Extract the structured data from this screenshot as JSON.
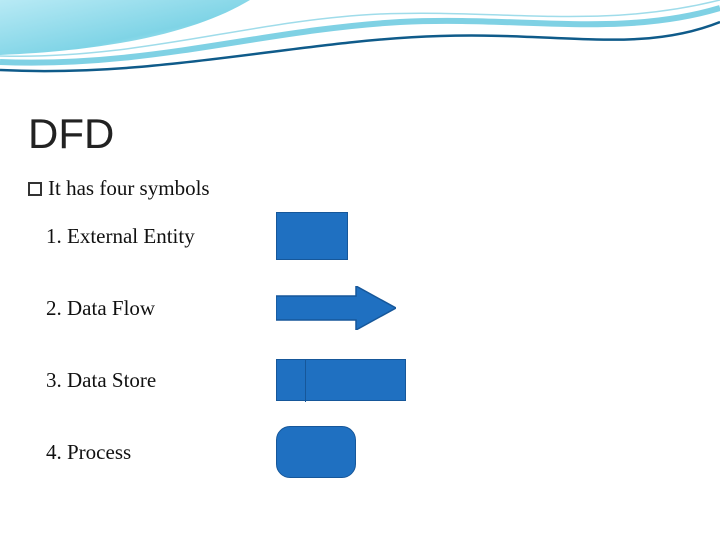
{
  "colors": {
    "shape_fill": "#1f70c1",
    "shape_stroke": "#16579a",
    "wave_cyan": "#7fd4e6",
    "wave_dark": "#0f5b8a"
  },
  "title": "DFD",
  "bullet": "It has four symbols",
  "items": [
    {
      "label": "1. External Entity",
      "shape": "rect"
    },
    {
      "label": "2. Data Flow",
      "shape": "arrow"
    },
    {
      "label": "3. Data Store",
      "shape": "store"
    },
    {
      "label": "4. Process",
      "shape": "process"
    }
  ]
}
